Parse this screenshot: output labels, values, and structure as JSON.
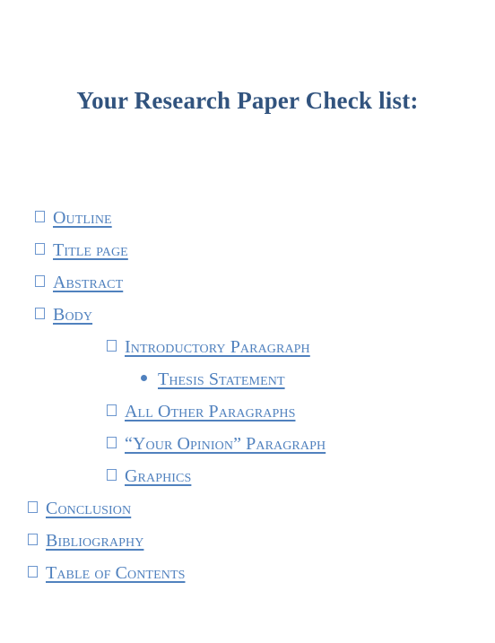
{
  "document": {
    "title": "Your Research Paper Check list:",
    "title_color": "#31537E",
    "item_color": "#5081BE",
    "background": "#ffffff"
  },
  "checklist": {
    "items": [
      {
        "label": "Outline",
        "level": 1,
        "bullet": "checkbox-square-icon"
      },
      {
        "label": "Title page",
        "level": 1,
        "bullet": "checkbox-square-icon"
      },
      {
        "label": "Abstract",
        "level": 1,
        "bullet": "checkbox-square-icon"
      },
      {
        "label": "Body",
        "level": 1,
        "bullet": "checkbox-square-icon"
      },
      {
        "label": "Introductory Paragraph",
        "level": 2,
        "bullet": "checkbox-square-icon"
      },
      {
        "label": "Thesis Statement",
        "level": 3,
        "bullet": "bullet-dot-icon"
      },
      {
        "label": "All Other Paragraphs",
        "level": 2,
        "bullet": "checkbox-square-icon"
      },
      {
        "label": "“Your Opinion” Paragraph",
        "level": 2,
        "bullet": "checkbox-square-icon"
      },
      {
        "label": "Graphics",
        "level": 2,
        "bullet": "checkbox-square-icon"
      },
      {
        "label": "Conclusion",
        "level": "outer",
        "bullet": "checkbox-square-icon"
      },
      {
        "label": "Bibliography",
        "level": "outer",
        "bullet": "checkbox-square-icon"
      },
      {
        "label": "Table of Contents",
        "level": "outer",
        "bullet": "checkbox-square-icon"
      }
    ]
  }
}
